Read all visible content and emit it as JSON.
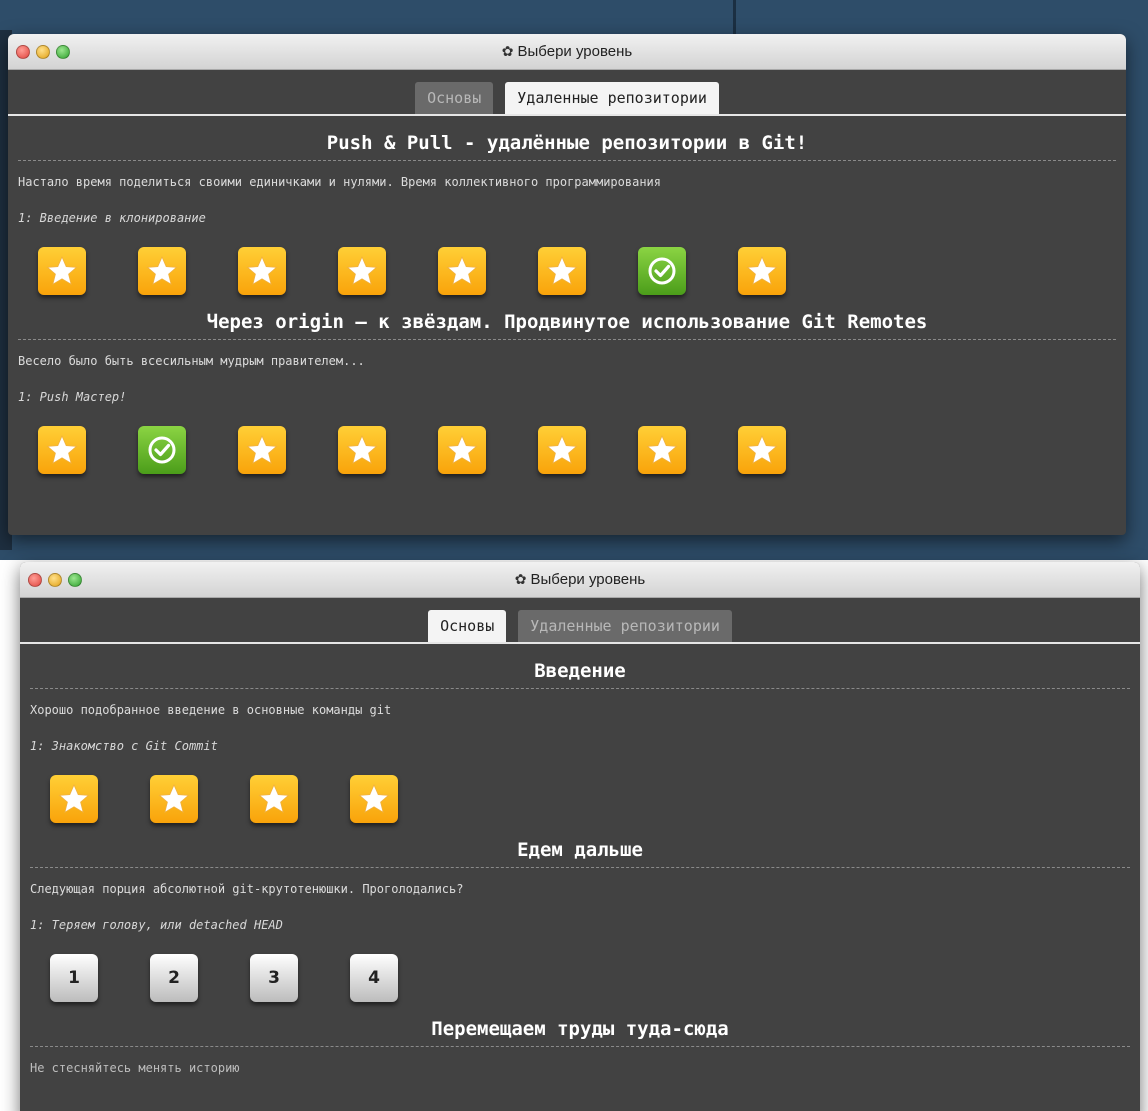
{
  "colors": {
    "window_bg": "#424242",
    "star_gold": "#fbb81c",
    "done_green": "#5cb51f",
    "desktop": "#2e4d69"
  },
  "window1": {
    "title": "Выбери уровень",
    "tabs": [
      {
        "label": "Основы",
        "active": false
      },
      {
        "label": "Удаленные репозитории",
        "active": true
      }
    ],
    "sections": [
      {
        "title": "Push & Pull - удалённые репозитории в Git!",
        "description": "Настало время поделиться своими единичками и нулями. Время коллективного программирования",
        "current_level": "1: Введение в клонирование",
        "levels": [
          "star",
          "star",
          "star",
          "star",
          "star",
          "star",
          "done",
          "star"
        ]
      },
      {
        "title": "Через origin – к звёздам. Продвинутое использование Git Remotes",
        "description": "Весело было быть всесильным мудрым правителем...",
        "current_level": "1: Push Мастер!",
        "levels": [
          "star",
          "done",
          "star",
          "star",
          "star",
          "star",
          "star",
          "star"
        ]
      }
    ]
  },
  "window2": {
    "title": "Выбери уровень",
    "tabs": [
      {
        "label": "Основы",
        "active": true
      },
      {
        "label": "Удаленные репозитории",
        "active": false
      }
    ],
    "sections": [
      {
        "title": "Введение",
        "description": "Хорошо подобранное введение в основные команды git",
        "current_level": "1: Знакомство с Git Commit",
        "levels": [
          "star",
          "star",
          "star",
          "star"
        ]
      },
      {
        "title": "Едем дальше",
        "description": "Следующая порция абсолютной git-крутотенюшки. Проголодались?",
        "current_level": "1: Теряем голову, или detached HEAD",
        "levels": [
          "1",
          "2",
          "3",
          "4"
        ]
      },
      {
        "title": "Перемещаем труды туда-сюда",
        "description": "Не стесняйтесь менять историю",
        "current_level": "",
        "levels": []
      }
    ]
  }
}
